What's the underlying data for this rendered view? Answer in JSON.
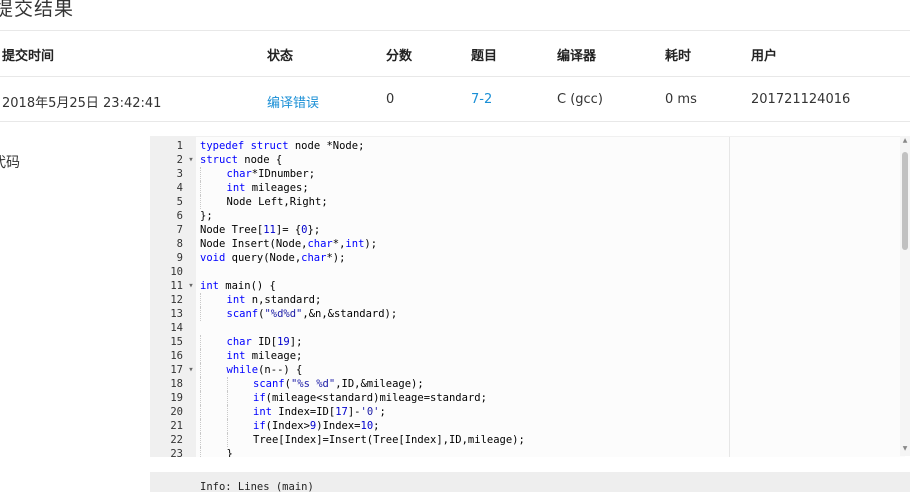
{
  "page": {
    "title": "提交结果",
    "code_label": "代码"
  },
  "table": {
    "headers": {
      "time": "提交时间",
      "status": "状态",
      "score": "分数",
      "problem": "题目",
      "compiler": "编译器",
      "duration": "耗时",
      "user": "用户"
    },
    "row": {
      "time": "2018年5月25日 23:42:41",
      "status": "编译错误",
      "score": "0",
      "problem": "7-2",
      "compiler": "C (gcc)",
      "duration": "0 ms",
      "user": "201721124016"
    }
  },
  "colors": {
    "link": "#1a8fd6",
    "keyword": "#0000ff"
  },
  "editor": {
    "lines": [
      {
        "n": "1",
        "fold": "",
        "indent": 0,
        "code": [
          [
            "kw",
            "typedef"
          ],
          [
            "t",
            " "
          ],
          [
            "kw",
            "struct"
          ],
          [
            "t",
            " node *Node;"
          ]
        ]
      },
      {
        "n": "2",
        "fold": "▾",
        "indent": 0,
        "code": [
          [
            "kw",
            "struct"
          ],
          [
            "t",
            " node {"
          ]
        ]
      },
      {
        "n": "3",
        "fold": "",
        "indent": 1,
        "code": [
          [
            "kw",
            "char"
          ],
          [
            "t",
            "*IDnumber;"
          ]
        ]
      },
      {
        "n": "4",
        "fold": "",
        "indent": 1,
        "code": [
          [
            "kw",
            "int"
          ],
          [
            "t",
            " mileages;"
          ]
        ]
      },
      {
        "n": "5",
        "fold": "",
        "indent": 1,
        "code": [
          [
            "t",
            "Node Left,Right;"
          ]
        ]
      },
      {
        "n": "6",
        "fold": "",
        "indent": 0,
        "code": [
          [
            "t",
            "};"
          ]
        ]
      },
      {
        "n": "7",
        "fold": "",
        "indent": 0,
        "code": [
          [
            "t",
            "Node Tree["
          ],
          [
            "num",
            "11"
          ],
          [
            "t",
            "]= {"
          ],
          [
            "num",
            "0"
          ],
          [
            "t",
            "};"
          ]
        ]
      },
      {
        "n": "8",
        "fold": "",
        "indent": 0,
        "code": [
          [
            "t",
            "Node Insert(Node,"
          ],
          [
            "kw",
            "char"
          ],
          [
            "t",
            "*,"
          ],
          [
            "kw",
            "int"
          ],
          [
            "t",
            ");"
          ]
        ]
      },
      {
        "n": "9",
        "fold": "",
        "indent": 0,
        "code": [
          [
            "kw",
            "void"
          ],
          [
            "t",
            " query(Node,"
          ],
          [
            "kw",
            "char"
          ],
          [
            "t",
            "*);"
          ]
        ]
      },
      {
        "n": "10",
        "fold": "",
        "indent": 0,
        "code": []
      },
      {
        "n": "11",
        "fold": "▾",
        "indent": 0,
        "code": [
          [
            "kw",
            "int"
          ],
          [
            "t",
            " main() {"
          ]
        ]
      },
      {
        "n": "12",
        "fold": "",
        "indent": 1,
        "code": [
          [
            "kw",
            "int"
          ],
          [
            "t",
            " n,standard;"
          ]
        ]
      },
      {
        "n": "13",
        "fold": "",
        "indent": 1,
        "code": [
          [
            "kw",
            "scanf"
          ],
          [
            "t",
            "("
          ],
          [
            "str",
            "\"%d%d\""
          ],
          [
            "t",
            ",&n,&standard);"
          ]
        ]
      },
      {
        "n": "14",
        "fold": "",
        "indent": 0,
        "code": []
      },
      {
        "n": "15",
        "fold": "",
        "indent": 1,
        "code": [
          [
            "kw",
            "char"
          ],
          [
            "t",
            " ID["
          ],
          [
            "num",
            "19"
          ],
          [
            "t",
            "];"
          ]
        ]
      },
      {
        "n": "16",
        "fold": "",
        "indent": 1,
        "code": [
          [
            "kw",
            "int"
          ],
          [
            "t",
            " mileage;"
          ]
        ]
      },
      {
        "n": "17",
        "fold": "▾",
        "indent": 1,
        "code": [
          [
            "kw",
            "while"
          ],
          [
            "t",
            "(n--) {"
          ]
        ]
      },
      {
        "n": "18",
        "fold": "",
        "indent": 2,
        "code": [
          [
            "kw",
            "scanf"
          ],
          [
            "t",
            "("
          ],
          [
            "str",
            "\"%s %d\""
          ],
          [
            "t",
            ",ID,&mileage);"
          ]
        ]
      },
      {
        "n": "19",
        "fold": "",
        "indent": 2,
        "code": [
          [
            "kw",
            "if"
          ],
          [
            "t",
            "(mileage<standard)mileage=standard;"
          ]
        ]
      },
      {
        "n": "20",
        "fold": "",
        "indent": 2,
        "code": [
          [
            "kw",
            "int"
          ],
          [
            "t",
            " Index=ID["
          ],
          [
            "num",
            "17"
          ],
          [
            "t",
            "]-"
          ],
          [
            "str",
            "'0'"
          ],
          [
            "t",
            ";"
          ]
        ]
      },
      {
        "n": "21",
        "fold": "",
        "indent": 2,
        "code": [
          [
            "kw",
            "if"
          ],
          [
            "t",
            "(Index>"
          ],
          [
            "num",
            "9"
          ],
          [
            "t",
            ")Index="
          ],
          [
            "num",
            "10"
          ],
          [
            "t",
            ";"
          ]
        ]
      },
      {
        "n": "22",
        "fold": "",
        "indent": 2,
        "code": [
          [
            "t",
            "Tree[Index]=Insert(Tree[Index],ID,mileage);"
          ]
        ]
      },
      {
        "n": "23",
        "fold": "",
        "indent": 1,
        "code": [
          [
            "t",
            "}"
          ]
        ]
      }
    ]
  },
  "result": {
    "text": "Info: Lines (main)"
  }
}
